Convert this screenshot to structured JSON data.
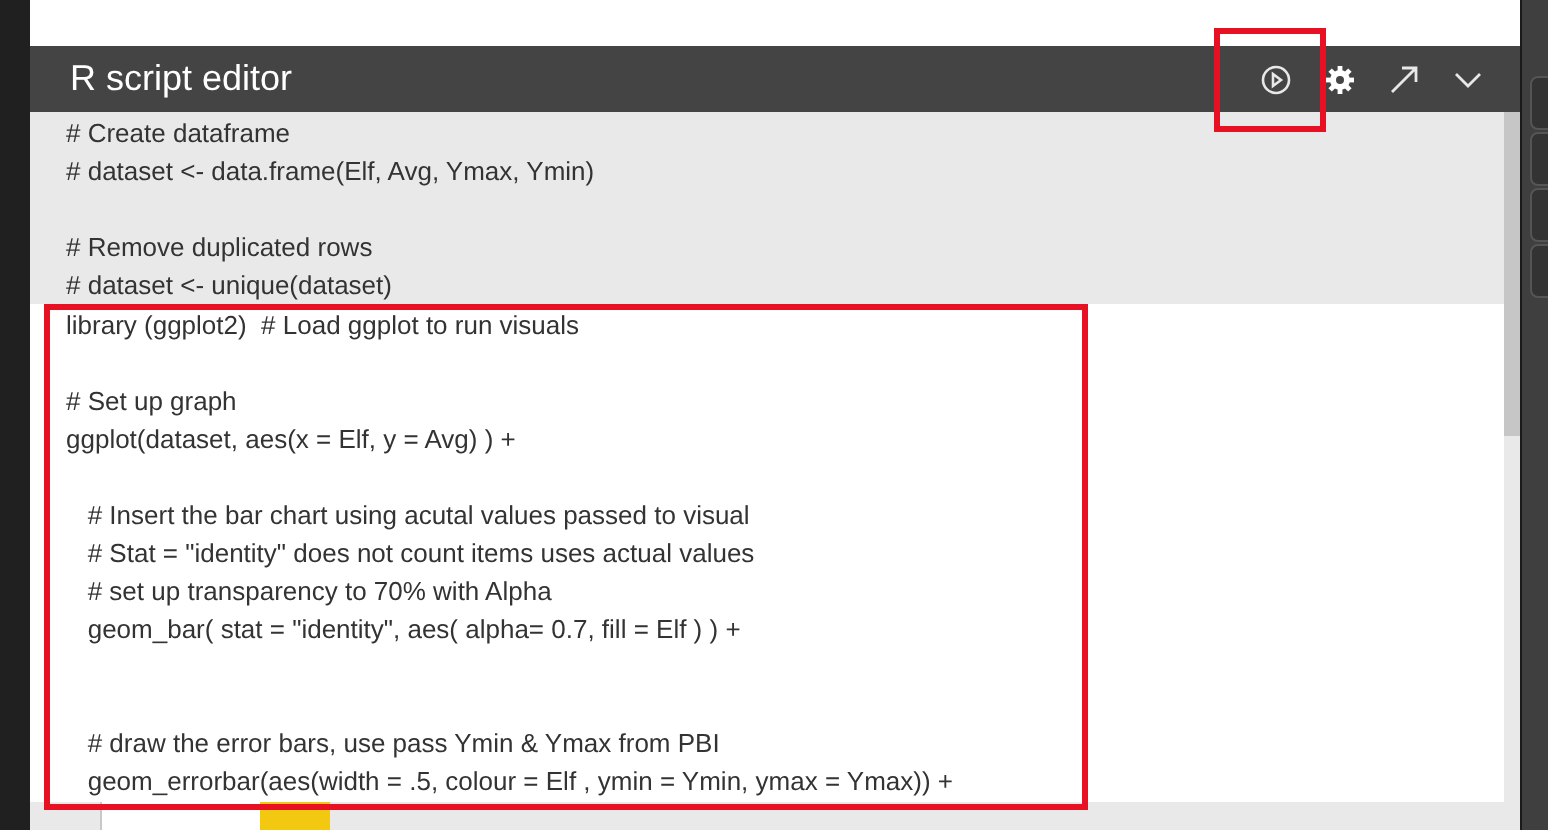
{
  "editor": {
    "title": "R script editor",
    "toolbar": [
      {
        "kind": "run"
      },
      {
        "kind": "settings"
      },
      {
        "kind": "expand"
      },
      {
        "kind": "collapse"
      }
    ],
    "sections": [
      {
        "selected": false,
        "lines": [
          {
            "kind": "code",
            "text": "# Create dataframe"
          },
          {
            "kind": "code",
            "text": "# dataset <- data.frame(Elf, Avg, Ymax, Ymin)"
          },
          {
            "kind": "blank"
          },
          {
            "kind": "code",
            "text": "# Remove duplicated rows"
          },
          {
            "kind": "code",
            "text": "# dataset <- unique(dataset)"
          }
        ]
      },
      {
        "selected": true,
        "lines": [
          {
            "kind": "code",
            "text": "library (ggplot2)  # Load ggplot to run visuals"
          },
          {
            "kind": "blank"
          },
          {
            "kind": "code",
            "text": "# Set up graph"
          },
          {
            "kind": "code",
            "text": "ggplot(dataset, aes(x = Elf, y = Avg) ) +"
          },
          {
            "kind": "blank"
          },
          {
            "kind": "code",
            "text": "   # Insert the bar chart using acutal values passed to visual"
          },
          {
            "kind": "code",
            "text": "   # Stat = \"identity\" does not count items uses actual values"
          },
          {
            "kind": "code",
            "text": "   # set up transparency to 70% with Alpha"
          },
          {
            "kind": "code",
            "text": "   geom_bar( stat = \"identity\", aes( alpha= 0.7, fill = Elf ) ) +"
          },
          {
            "kind": "blank"
          },
          {
            "kind": "blank"
          },
          {
            "kind": "code",
            "text": "   # draw the error bars, use pass Ymin & Ymax from PBI"
          },
          {
            "kind": "code",
            "text": "   geom_errorbar(aes(width = .5, colour = Elf , ymin = Ymin, ymax = Ymax)) +"
          }
        ]
      }
    ]
  }
}
